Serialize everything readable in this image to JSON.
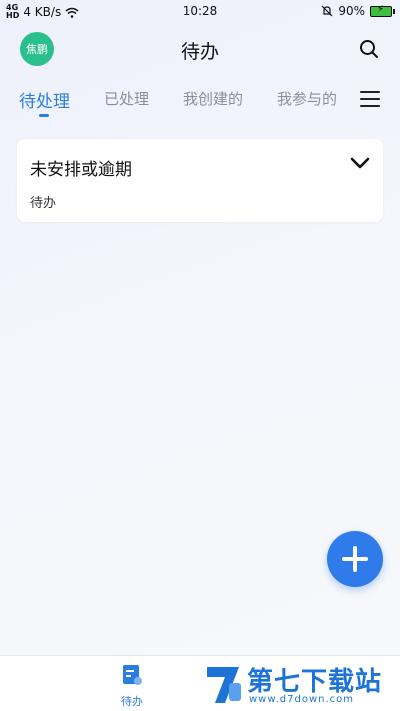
{
  "status_bar": {
    "network_speed": "4 KB/s",
    "time": "10:28",
    "battery": "90%",
    "signal_icon": "signal-icon",
    "wifi_icon": "wifi-icon",
    "mute_icon": "mute-icon"
  },
  "header": {
    "avatar_text": "焦鹏",
    "title": "待办",
    "search_icon": "search-icon"
  },
  "tabs": [
    {
      "label": "待处理",
      "active": true
    },
    {
      "label": "已处理",
      "active": false
    },
    {
      "label": "我创建的",
      "active": false
    },
    {
      "label": "我参与的",
      "active": false
    }
  ],
  "card": {
    "title": "未安排或逾期",
    "subtitle": "待办"
  },
  "bottom_nav": {
    "items": [
      {
        "label": "待办",
        "active": true
      }
    ]
  },
  "watermark": {
    "text": "第七下载站",
    "url": "www.d7down.com"
  },
  "colors": {
    "accent": "#2a7de1",
    "avatar": "#2bbf8e",
    "fab": "#2f7bea"
  }
}
